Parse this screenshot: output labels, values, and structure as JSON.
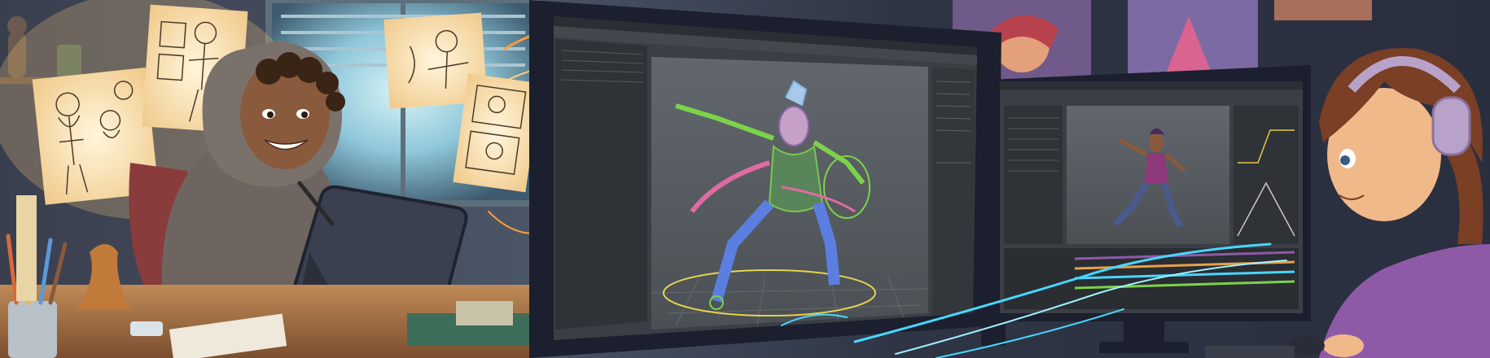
{
  "scene": {
    "kind": "illustration",
    "subjects": [
      "artist-with-tablet",
      "animator-with-headphones"
    ],
    "palette": {
      "wall": "#2b3140",
      "window_glow": "#9fd7e6",
      "desk": "#b07a4a",
      "hoodie": "#6f6560",
      "skin_left": "#8a5a3c",
      "hair_right": "#7a3f24",
      "headphones": "#b9a2c9",
      "sweater_right": "#8e5aa8",
      "monitor_frame": "#1c1f2e",
      "viewport_bg": "#555a60",
      "wireframe_green": "#7cd34a",
      "wireframe_blue": "#5b7fe0",
      "wireframe_pink": "#e06aa3",
      "energy_cyan": "#49d6ff",
      "energy_orange": "#ff9a3c"
    }
  },
  "icons": [
    "pencil-icon",
    "tablet-icon",
    "headphones-icon",
    "mouse-icon"
  ]
}
